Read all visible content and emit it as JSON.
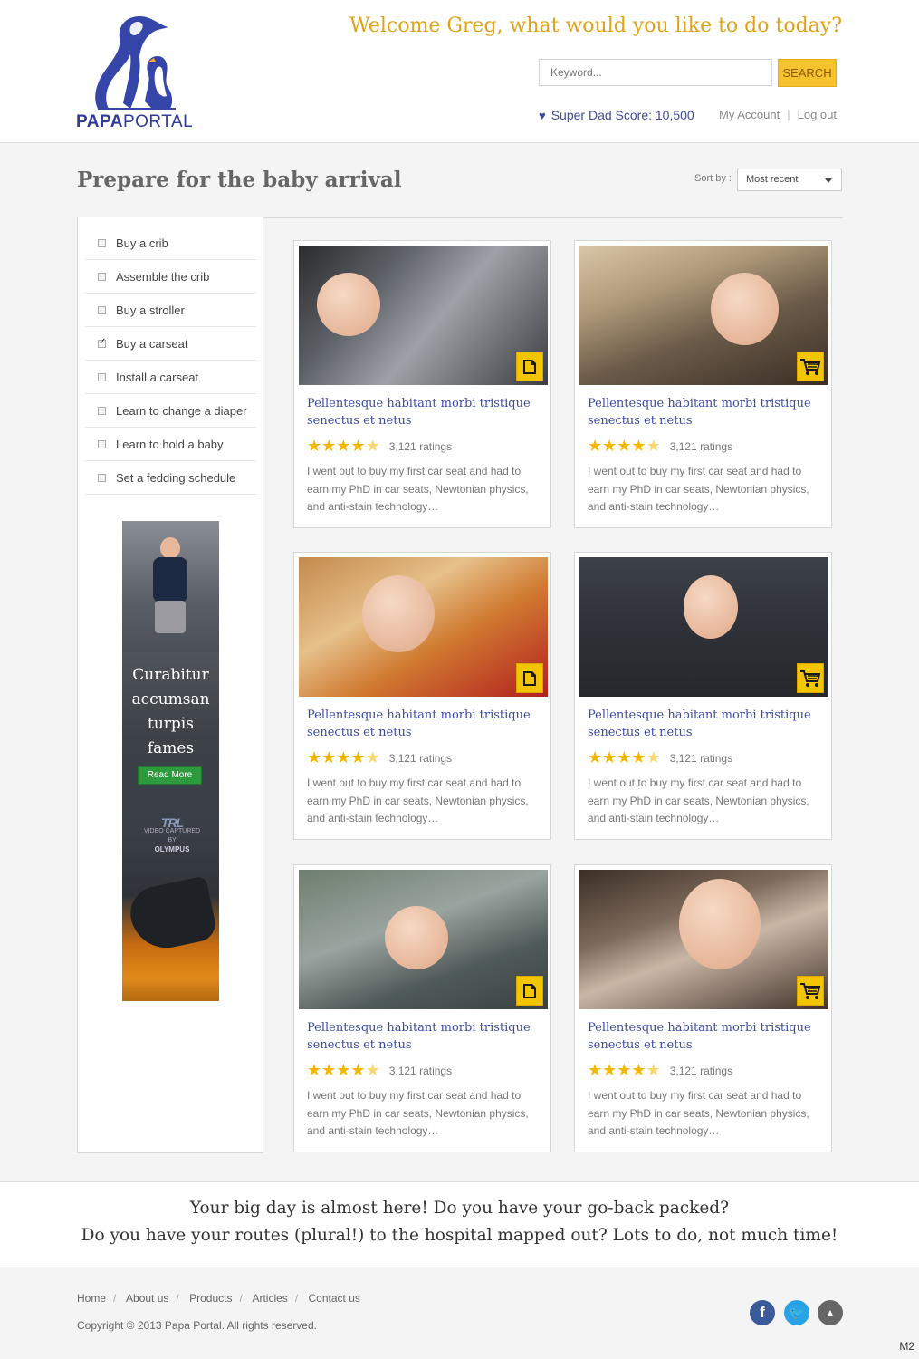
{
  "header": {
    "logo_text_bold": "PAPA",
    "logo_text_light": "PORTAL",
    "welcome": "Welcome Greg, what would you like to do today?",
    "search_placeholder": "Keyword...",
    "search_button": "SEARCH",
    "score_label": "Super Dad Score: 10,500",
    "my_account": "My Account",
    "log_out": "Log out",
    "separator": "|"
  },
  "page": {
    "title": "Prepare for the baby arrival",
    "sort_label": "Sort by :",
    "sort_value": "Most recent"
  },
  "sidebar": {
    "tasks": [
      {
        "label": "Buy a crib",
        "checked": false
      },
      {
        "label": "Assemble the crib",
        "checked": false
      },
      {
        "label": "Buy a stroller",
        "checked": false
      },
      {
        "label": "Buy a carseat",
        "checked": true
      },
      {
        "label": "Install a carseat",
        "checked": false
      },
      {
        "label": "Learn to change a diaper",
        "checked": false
      },
      {
        "label": "Learn to hold a baby",
        "checked": false
      },
      {
        "label": "Set a fedding schedule",
        "checked": false
      }
    ],
    "ad": {
      "line1": "Curabitur",
      "line2": "accumsan",
      "line3": "turpis",
      "line4": "fames",
      "button": "Read More",
      "brand_logo": "TRL",
      "brand_caption": "VIDEO CAPTURED BY",
      "brand_name": "OLYMPUS"
    }
  },
  "cards": [
    {
      "title": "Pellentesque habitant morbi tristique senectus et netus",
      "ratings": "3,121 ratings",
      "rating_value": 4.5,
      "badge": "document-icon",
      "desc": "I went out to buy my first car seat and had to earn my PhD in car seats, Newtonian physics, and anti-stain technology…"
    },
    {
      "title": "Pellentesque habitant morbi tristique senectus et netus",
      "ratings": "3,121 ratings",
      "rating_value": 4.5,
      "badge": "cart-icon",
      "desc": "I went out to buy my first car seat and had to earn my PhD in car seats, Newtonian physics, and anti-stain technology…"
    },
    {
      "title": "Pellentesque habitant morbi tristique senectus et netus",
      "ratings": "3,121 ratings",
      "rating_value": 4.5,
      "badge": "document-icon",
      "desc": "I went out to buy my first car seat and had to earn my PhD in car seats, Newtonian physics, and anti-stain technology…"
    },
    {
      "title": "Pellentesque habitant morbi tristique senectus et netus",
      "ratings": "3,121 ratings",
      "rating_value": 4.5,
      "badge": "cart-icon",
      "desc": "I went out to buy my first car seat and had to earn my PhD in car seats, Newtonian physics, and anti-stain technology…"
    },
    {
      "title": "Pellentesque habitant morbi tristique senectus et netus",
      "ratings": "3,121 ratings",
      "rating_value": 4.5,
      "badge": "document-icon",
      "desc": "I went out to buy my first car seat and had to earn my PhD in car seats, Newtonian physics, and anti-stain technology…"
    },
    {
      "title": "Pellentesque habitant morbi tristique senectus et netus",
      "ratings": "3,121 ratings",
      "rating_value": 4.5,
      "badge": "cart-icon",
      "desc": "I went out to buy my first car seat and had to earn my PhD in car seats, Newtonian physics, and anti-stain technology…"
    }
  ],
  "message": {
    "line1": "Your big day is almost here! Do you have your go-back packed?",
    "line2": "Do you have your routes (plural!) to the hospital mapped out? Lots to do, not much time!"
  },
  "footer": {
    "links": [
      "Home",
      "About us",
      "Products",
      "Articles",
      "Contact us"
    ],
    "separator": "/",
    "copyright": "Copyright  ©  2013   Papa Portal.   All rights reserved.",
    "corner_label": "M2"
  },
  "colors": {
    "brand_blue": "#3b4aa5",
    "accent_yellow": "#f6c22d",
    "welcome_gold": "#e0a21a",
    "ad_button_green": "#2e9a3e"
  }
}
